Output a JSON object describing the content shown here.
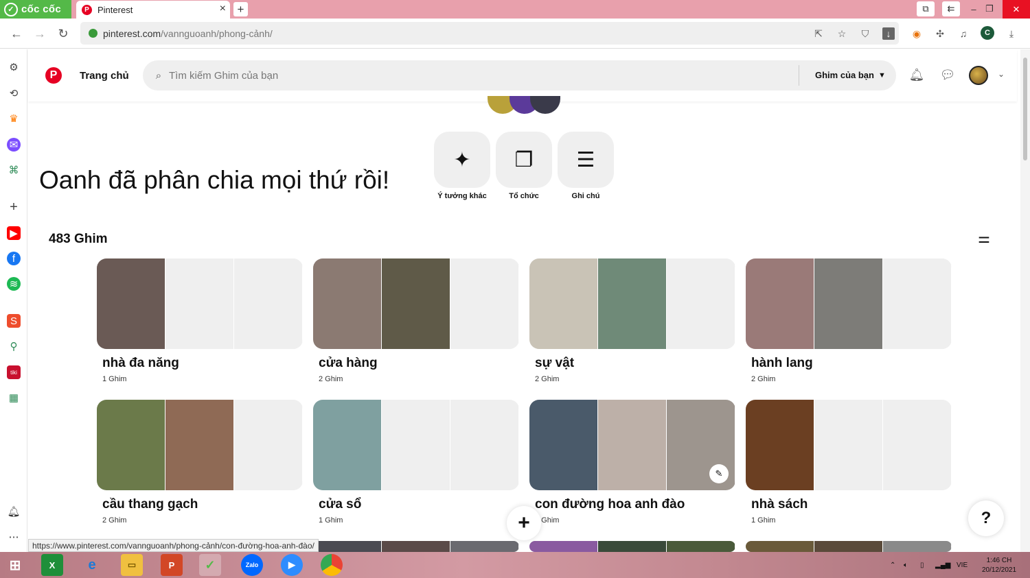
{
  "browser": {
    "brand": "cốc cốc",
    "tab_title": "Pinterest",
    "new_tab_symbol": "+",
    "url_host": "pinterest.com",
    "url_path": "/vannguoanh/phong-cảnh/",
    "status_url": "https://www.pinterest.com/vannguoanh/phong-cảnh/con-đường-hoa-anh-đào/",
    "profile_initial": "C"
  },
  "header": {
    "home_label": "Trang chủ",
    "search_placeholder": "Tìm kiếm Ghim của bạn",
    "scope_label": "Ghim của bạn"
  },
  "board": {
    "caption": "Oanh đã phân chia mọi thứ rồi!",
    "pin_count": "483 Ghim",
    "actions": [
      {
        "label": "Ý tưởng khác",
        "icon": "sparkle-icon"
      },
      {
        "label": "Tổ chức",
        "icon": "organize-icon"
      },
      {
        "label": "Ghi chú",
        "icon": "notes-icon"
      }
    ],
    "sections": [
      {
        "name": "nhà đa năng",
        "count": "1 Ghim",
        "colors": [
          "#6a5a55"
        ]
      },
      {
        "name": "cửa hàng",
        "count": "2 Ghim",
        "colors": [
          "#8b7a72",
          "#5f5a48"
        ]
      },
      {
        "name": "sự vật",
        "count": "2 Ghim",
        "colors": [
          "#c9c3b6",
          "#6f8a78"
        ]
      },
      {
        "name": "hành lang",
        "count": "2 Ghim",
        "colors": [
          "#9a7a78",
          "#7d7c78"
        ]
      },
      {
        "name": "cầu thang gạch",
        "count": "2 Ghim",
        "colors": [
          "#6b7a4a",
          "#8f6a55"
        ]
      },
      {
        "name": "cửa sổ",
        "count": "1 Ghim",
        "colors": [
          "#7fa0a0"
        ]
      },
      {
        "name": "con đường hoa anh đào",
        "count": "3 Ghim",
        "colors": [
          "#4a5a6a",
          "#bdb0a8",
          "#9d958e"
        ]
      },
      {
        "name": "nhà sách",
        "count": "1 Ghim",
        "colors": [
          "#6b3f22"
        ]
      }
    ]
  },
  "taskbar": {
    "lang": "VIE",
    "time": "1:46 CH",
    "date": "20/12/2021"
  },
  "colors": {
    "pinterest_red": "#e60023",
    "coccoc_green": "#54b948",
    "tabbar_pink": "#e8a0ac"
  }
}
